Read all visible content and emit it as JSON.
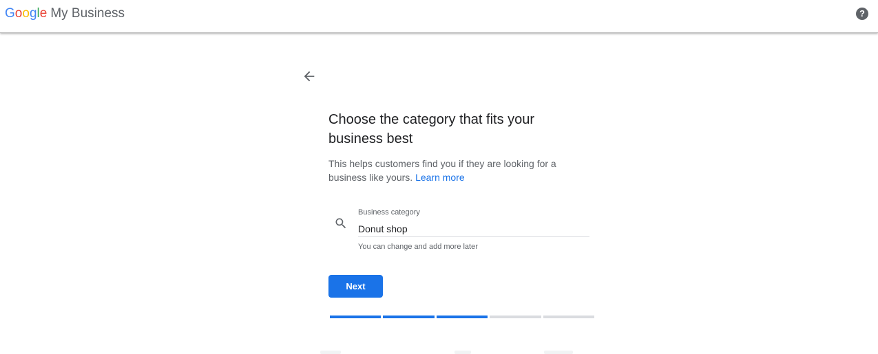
{
  "header": {
    "logo_word": "Google",
    "product_name": "My Business",
    "help_icon": "help-circle-icon"
  },
  "main": {
    "back_icon": "arrow-back-icon",
    "title": "Choose the category that fits your business best",
    "description": "This helps customers find you if they are looking for a business like yours.",
    "learn_more": "Learn more",
    "field": {
      "label": "Business category",
      "value": "Donut shop",
      "hint": "You can change and add more later",
      "icon": "search-icon"
    },
    "next_label": "Next",
    "progress": {
      "total_steps": 5,
      "completed_steps": 3
    }
  },
  "colors": {
    "accent": "#1a73e8",
    "progress_inactive": "#dadce0"
  }
}
